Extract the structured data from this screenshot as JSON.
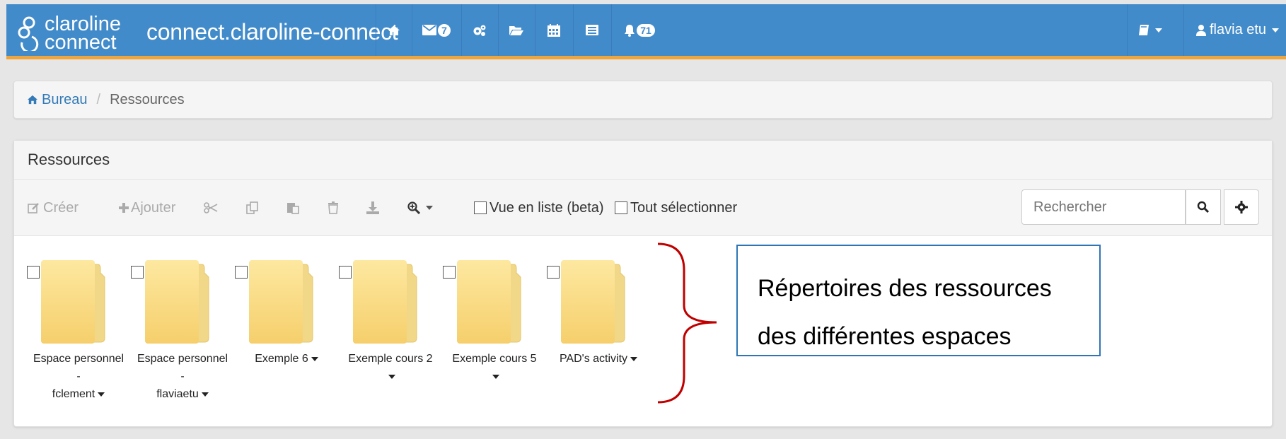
{
  "navbar": {
    "logo_line1": "claroline",
    "logo_line2": "connect",
    "site_title": "connect.claroline-connect",
    "messages_badge": "7",
    "notifications_badge": "71",
    "user_name": "flavia etu",
    "colors": {
      "bar": "#428bca",
      "accent_border": "#f0a43c"
    }
  },
  "breadcrumb": {
    "home": "Bureau",
    "current": "Ressources"
  },
  "panel": {
    "title": "Ressources",
    "toolbar": {
      "create": "Créer",
      "add": "Ajouter",
      "list_view": "Vue en liste (beta)",
      "select_all": "Tout sélectionner",
      "search_placeholder": "Rechercher"
    },
    "folders": [
      {
        "line1": "Espace personnel",
        "line2": "-",
        "line3": "fclement"
      },
      {
        "line1": "Espace personnel",
        "line2": "-",
        "line3": "flaviaetu"
      },
      {
        "line1": "Exemple 6"
      },
      {
        "line1": "Exemple cours 2"
      },
      {
        "line1": "Exemple cours 5"
      },
      {
        "line1": "PAD's activity"
      }
    ]
  },
  "annotation": {
    "line1": "Répertoires des ressources",
    "line2": "des différentes espaces",
    "border_color": "#2e75b6",
    "brace_color": "#c00000"
  }
}
